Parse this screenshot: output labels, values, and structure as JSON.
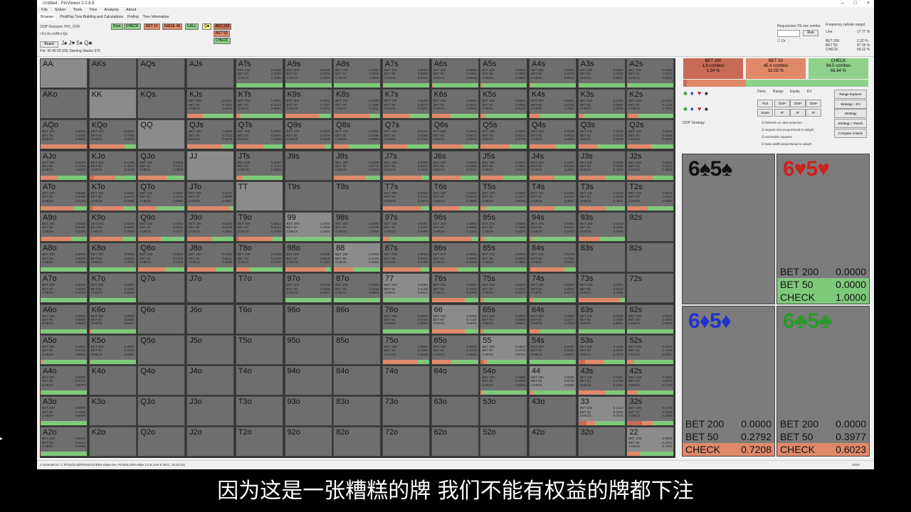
{
  "window": {
    "title": "Untitled - PioViewer 2.0.6.8"
  },
  "menu": [
    "File",
    "Solver",
    "Tools",
    "Tree",
    "Analysis",
    "About"
  ],
  "subtabs": [
    "Browser",
    "PostFlop Tree Building and Calculations",
    "Preflop",
    "Tree Information"
  ],
  "toolbar": {
    "oop_decision": "OOP Decision: PIO_CFR",
    "line": "r:0:c:b:c:b40:c:Qc",
    "board_btn": "Board",
    "board": "J♠ J♥ 5♦ Q♣",
    "pot": "Pot: 40 40 65 (65) Starting Stacks 975",
    "actions": [
      "Root",
      "CHECK",
      "BET 10",
      "RAISE 48",
      "CALL",
      "Q♣"
    ],
    "actions2": [
      "BET 200",
      "BET 50",
      "CHECK"
    ],
    "req_label": "Requencies VS one combo",
    "run_btn": "Run",
    "freq_label": "Frequency (whole range)",
    "freq_line": "Line",
    "freq_line_val": "17.77 %",
    "freq_rows": [
      [
        "BET 200",
        "2.32 %"
      ],
      [
        "BET 50",
        "47.36 %"
      ],
      [
        "CHECK",
        "50.22 %"
      ]
    ],
    "or_label": "Or"
  },
  "grid": [
    [
      [
        "AA",
        null
      ],
      [
        "AKs",
        null
      ],
      [
        "AQs",
        null
      ],
      [
        "AJs",
        null
      ],
      [
        "ATs",
        [
          0,
          0,
          1
        ]
      ],
      [
        "A9s",
        [
          0,
          0,
          1
        ]
      ],
      [
        "A8s",
        [
          0,
          0,
          1
        ]
      ],
      [
        "A7s",
        [
          0,
          0.0299,
          0.9701
        ]
      ],
      [
        "A6s",
        [
          0,
          0.0351,
          0.9649
        ]
      ],
      [
        "A5s",
        [
          0,
          0.0394,
          0.9606
        ]
      ],
      [
        "A4s",
        [
          0,
          0.0276,
          0.9724
        ]
      ],
      [
        "A3s",
        [
          0,
          0.0199,
          0.9801
        ]
      ],
      [
        "A2s",
        [
          0,
          0.0172,
          0.9828
        ]
      ]
    ],
    [
      [
        "AKo",
        null
      ],
      [
        "KK",
        null
      ],
      [
        "KQs",
        null
      ],
      [
        "KJs",
        [
          0.0001,
          0.3384,
          0.6615
        ]
      ],
      [
        "KTs",
        [
          0.0001,
          0.0918,
          0.9081
        ]
      ],
      [
        "K9s",
        [
          0.0001,
          0.7327,
          0.2672
        ]
      ],
      [
        "K8s",
        [
          0,
          0.7589,
          0.2411
        ]
      ],
      [
        "K7s",
        [
          0.0005,
          0.5674,
          0.4321
        ]
      ],
      [
        "K6s",
        [
          0.0004,
          0.4041,
          0.5955
        ]
      ],
      [
        "K5s",
        [
          0.0002,
          0.0868,
          0.913
        ]
      ],
      [
        "K4s",
        [
          0.0051,
          0.2138,
          0.7811
        ]
      ],
      [
        "K3s",
        [
          0.0105,
          0.095,
          0.8945
        ]
      ],
      [
        "K2s",
        [
          0.0191,
          0.2158,
          0.7651
        ]
      ]
    ],
    [
      [
        "AQo",
        [
          0,
          1,
          0
        ]
      ],
      [
        "KQo",
        [
          0,
          0.7558,
          0.2442
        ]
      ],
      [
        "QQ",
        null
      ],
      [
        "QJs",
        [
          0,
          0.7422,
          0.2578
        ]
      ],
      [
        "QTs",
        [
          0,
          0.5875,
          0.4125
        ]
      ],
      [
        "Q9s",
        [
          0,
          0.8474,
          0.1526
        ]
      ],
      [
        "Q8s",
        [
          0,
          0.3198,
          0.6802
        ]
      ],
      [
        "Q7s",
        [
          0,
          0.5268,
          0.4732
        ]
      ],
      [
        "Q6s",
        [
          0,
          0.6671,
          0.3329
        ]
      ],
      [
        "Q5s",
        [
          0,
          0.6221,
          0.3779
        ]
      ],
      [
        "Q4s",
        [
          0.0036,
          0.5615,
          0.4349
        ]
      ],
      [
        "Q3s",
        [
          0.0016,
          0.4148,
          0.5836
        ]
      ],
      [
        "Q2s",
        [
          0.0024,
          0.5106,
          0.487
        ]
      ]
    ],
    [
      [
        "AJo",
        [
          0,
          0.3264,
          0.5672
        ]
      ],
      [
        "KJo",
        [
          0.1006,
          0.4647,
          0.4448
        ]
      ],
      [
        "QJo",
        [
          0,
          0.6151,
          0.3848
        ]
      ],
      [
        "JJ",
        null
      ],
      [
        "JTs",
        [
          0,
          0.1434,
          0.8566
        ]
      ],
      [
        "J9s",
        null
      ],
      [
        "J8s",
        [
          0,
          0.6715,
          0.3285
        ]
      ],
      [
        "J7s",
        [
          0,
          0.8375,
          0.1625
        ]
      ],
      [
        "J6s",
        [
          0,
          0.6286,
          0.3714
        ]
      ],
      [
        "J5s",
        [
          0,
          0.4863,
          0.5137
        ]
      ],
      [
        "J4s",
        [
          0,
          0.5446,
          0.4554
        ]
      ],
      [
        "J3s",
        [
          0,
          0.5685,
          0.4315
        ]
      ],
      [
        "J2s",
        [
          0,
          0.5442,
          0.4558
        ]
      ]
    ],
    [
      [
        "ATo",
        [
          0,
          0.6486,
          0.2745
        ]
      ],
      [
        "KTo",
        [
          0.0852,
          0.6462,
          0.2686
        ]
      ],
      [
        "QTo",
        [
          0,
          0.4015,
          0.5985
        ]
      ],
      [
        "JTo",
        [
          0.0137,
          0.8896,
          0.0967
        ]
      ],
      [
        "TT",
        null
      ],
      [
        "T9s",
        null
      ],
      [
        "T8s",
        null
      ],
      [
        "T7s",
        [
          0,
          0.8124,
          0.1876
        ]
      ],
      [
        "T6s",
        [
          0,
          0.604,
          0.396
        ]
      ],
      [
        "T5s",
        [
          0,
          0.1241,
          0.8759
        ]
      ],
      [
        "T4s",
        [
          0,
          0.5353,
          0.4647
        ]
      ],
      [
        "T3s",
        [
          0.043,
          0.5639,
          0.3931
        ]
      ],
      [
        "T2s",
        [
          0.0076,
          0.4324,
          0.56
        ]
      ]
    ],
    [
      [
        "A9o",
        [
          0.0244,
          0.6356,
          0.34
        ]
      ],
      [
        "K9o",
        [
          0.0244,
          0.6856,
          0.29
        ]
      ],
      [
        "Q9o",
        [
          0,
          0.4883,
          0.5117
        ]
      ],
      [
        "J9o",
        [
          0,
          0.5436,
          0.4564
        ]
      ],
      [
        "T9o",
        [
          0.0801,
          0.951,
          0.2788
        ]
      ],
      [
        "99",
        [
          0,
          0,
          1
        ]
      ],
      [
        "98s",
        [
          0,
          0,
          1
        ]
      ],
      [
        "97s",
        [
          0.0091,
          0.1394,
          0.8499
        ]
      ],
      [
        "96s",
        [
          0,
          0.8655,
          0.1345
        ]
      ],
      [
        "95s",
        [
          0,
          0.0866,
          0.9134
        ]
      ],
      [
        "94s",
        [
          0.0061,
          0.0534,
          0.9405
        ]
      ],
      [
        "93s",
        [
          0.0144,
          0.4562,
          0.5294
        ]
      ],
      [
        "92s",
        null
      ]
    ],
    [
      [
        "A8o",
        [
          0,
          0,
          1
        ]
      ],
      [
        "K8o",
        [
          0,
          0,
          1
        ]
      ],
      [
        "Q8o",
        [
          0,
          0.5796,
          0.4204
        ]
      ],
      [
        "J8o",
        [
          0,
          0.6141,
          0.3859
        ]
      ],
      [
        "T8o",
        [
          0.0068,
          0.2722,
          0.721
        ]
      ],
      [
        "98o",
        [
          0,
          0.8619,
          0.1381
        ]
      ],
      [
        "88",
        [
          0,
          0.4,
          0.58
        ]
      ],
      [
        "87s",
        [
          0,
          0.821,
          0.179
        ]
      ],
      [
        "86s",
        [
          0,
          0.566,
          0.434
        ]
      ],
      [
        "85s",
        [
          0,
          0,
          1
        ]
      ],
      [
        "84s",
        [
          0.0278,
          0.725,
          0.2472
        ]
      ],
      [
        "83s",
        null
      ],
      [
        "82s",
        null
      ]
    ],
    [
      [
        "A7o",
        [
          0,
          0,
          0.9139
        ]
      ],
      [
        "K7o",
        [
          0,
          0,
          0.9482
        ]
      ],
      [
        "Q7o",
        null
      ],
      [
        "J7o",
        null
      ],
      [
        "T7o",
        null
      ],
      [
        "97o",
        [
          0,
          0.0053,
          0.9947
        ]
      ],
      [
        "87o",
        [
          0,
          0.0018,
          0.9982
        ]
      ],
      [
        "77",
        [
          0,
          0.0159,
          0.9841
        ]
      ],
      [
        "76s",
        [
          0,
          0.7204,
          0.2796
        ]
      ],
      [
        "75s",
        [
          0,
          0.0727,
          0.9273
        ]
      ],
      [
        "74s",
        [
          0,
          0.0826,
          0.9174
        ]
      ],
      [
        "73s",
        [
          0,
          0.8918,
          0.1082
        ]
      ],
      [
        "72s",
        null
      ]
    ],
    [
      [
        "A6o",
        [
          0,
          0,
          0.9192
        ]
      ],
      [
        "K6o",
        [
          0,
          0.0583,
          0.9417
        ]
      ],
      [
        "Q6o",
        null
      ],
      [
        "J6o",
        null
      ],
      [
        "T6o",
        null
      ],
      [
        "96o",
        null
      ],
      [
        "86o",
        null
      ],
      [
        "76o",
        [
          0,
          0,
          1
        ]
      ],
      [
        "66",
        [
          0,
          0.7124,
          0.2876
        ]
      ],
      [
        "65s",
        [
          0,
          0.0659,
          0.9341
        ]
      ],
      [
        "64s",
        [
          0,
          0.2377,
          0.7623
        ]
      ],
      [
        "63s",
        [
          0,
          0.0009,
          0.9991
        ]
      ],
      [
        "62s",
        [
          0,
          0,
          1
        ]
      ]
    ],
    [
      [
        "A5o",
        [
          0,
          0.0416,
          0.9584
        ]
      ],
      [
        "K5o",
        [
          0,
          0.0144,
          0.9856
        ]
      ],
      [
        "Q5o",
        null
      ],
      [
        "J5o",
        null
      ],
      [
        "T5o",
        null
      ],
      [
        "95o",
        null
      ],
      [
        "85o",
        null
      ],
      [
        "75o",
        [
          0,
          0.7452,
          0.2548
        ]
      ],
      [
        "65o",
        [
          0,
          0.4178,
          0.5822
        ]
      ],
      [
        "55",
        [
          0.0524,
          0.0772,
          0.8704
        ]
      ],
      [
        "54s",
        [
          0,
          0.003,
          0.997
        ]
      ],
      [
        "53s",
        [
          0.1482,
          0.394,
          0.4578
        ]
      ],
      [
        "52s",
        [
          0,
          0.1419,
          0.8581
        ]
      ]
    ],
    [
      [
        "A4o",
        [
          0,
          0.021,
          0.979
        ]
      ],
      [
        "K4o",
        null
      ],
      [
        "Q4o",
        null
      ],
      [
        "J4o",
        null
      ],
      [
        "T4o",
        null
      ],
      [
        "94o",
        null
      ],
      [
        "84o",
        null
      ],
      [
        "74o",
        null
      ],
      [
        "64o",
        null
      ],
      [
        "54o",
        [
          0,
          0.0345,
          0.9655
        ]
      ],
      [
        "44",
        [
          0,
          0.0735,
          0.9265
        ]
      ],
      [
        "43s",
        [
          0.0051,
          0.5788,
          0.4161
        ]
      ],
      [
        "42s",
        [
          0,
          0.2276,
          0.7724
        ]
      ]
    ],
    [
      [
        "A3o",
        [
          0,
          0.0115,
          0.9485
        ]
      ],
      [
        "K3o",
        null
      ],
      [
        "Q3o",
        null
      ],
      [
        "J3o",
        null
      ],
      [
        "T3o",
        null
      ],
      [
        "93o",
        null
      ],
      [
        "83o",
        null
      ],
      [
        "73o",
        null
      ],
      [
        "63o",
        null
      ],
      [
        "53o",
        null
      ],
      [
        "43o",
        null
      ],
      [
        "33",
        [
          0.2122,
          0.22,
          0.7878
        ]
      ],
      [
        "32s",
        [
          0.3175,
          0.2266,
          0.4559
        ]
      ]
    ],
    [
      [
        "A2o",
        [
          0,
          0.0134,
          0.9866
        ]
      ],
      [
        "K2o",
        null
      ],
      [
        "Q2o",
        null
      ],
      [
        "J2o",
        null
      ],
      [
        "T2o",
        null
      ],
      [
        "92o",
        null
      ],
      [
        "82o",
        null
      ],
      [
        "72o",
        null
      ],
      [
        "62o",
        null
      ],
      [
        "52o",
        null
      ],
      [
        "42o",
        null
      ],
      [
        "32o",
        null
      ],
      [
        "22",
        [
          0.0,
          0.2691,
          0.7304
        ]
      ]
    ]
  ],
  "labels": {
    "bet200": "BET 200",
    "bet50": "BET 50",
    "check": "CHECK"
  },
  "summary": [
    {
      "label": "BET 200",
      "combos": "1.9 combos",
      "pct": "1.34 %"
    },
    {
      "label": "BET 50",
      "combos": "45.4 combos",
      "pct": "32.03 %"
    },
    {
      "label": "CHECK",
      "combos": "94.5 combos",
      "pct": "66.64 %"
    }
  ],
  "panel": {
    "col_headers": [
      "Done",
      "Range",
      "Equity",
      "EV"
    ],
    "full": "Full",
    "oop": "OOP",
    "ip": "IP",
    "zoom": "Zoom",
    "oop_strategy": "OOP Strategy",
    "right_btns": [
      "Range Explorer",
      "Strategy + EV",
      "Strategy",
      "Strategy + Reach",
      "Compare Actions"
    ],
    "checks": [
      "Refresh on view selection",
      "Square size proportional to weight",
      "Normalize squares",
      "Bars width proportional to weight"
    ]
  },
  "combos": [
    {
      "left": "6",
      "ls": "♠",
      "right": "5",
      "rs": "♠",
      "color": "#111",
      "values": null
    },
    {
      "left": "6",
      "ls": "♥",
      "right": "5",
      "rs": "♥",
      "color": "#c22",
      "values": [
        "0.0000",
        "0.0000",
        "1.0000"
      ]
    },
    {
      "left": "6",
      "ls": "♦",
      "right": "5",
      "rs": "♦",
      "color": "#2233cc",
      "values": [
        "0.0000",
        "0.2792",
        "0.7208"
      ]
    },
    {
      "left": "6",
      "ls": "♣",
      "right": "5",
      "rs": "♣",
      "color": "#2a9a2a",
      "values": [
        "0.0000",
        "0.3977",
        "0.6023"
      ]
    }
  ],
  "status": {
    "left": "Connected to: C:\\PioSOLVER\\PioSOLVER2-edge.exe, PioSOLVER-edge 2.0.6 (Jan 9 2021, 15:24:10)",
    "right": "Done"
  },
  "subtitle": "因为这是一张糟糕的牌 我们不能有权益的牌都下注"
}
